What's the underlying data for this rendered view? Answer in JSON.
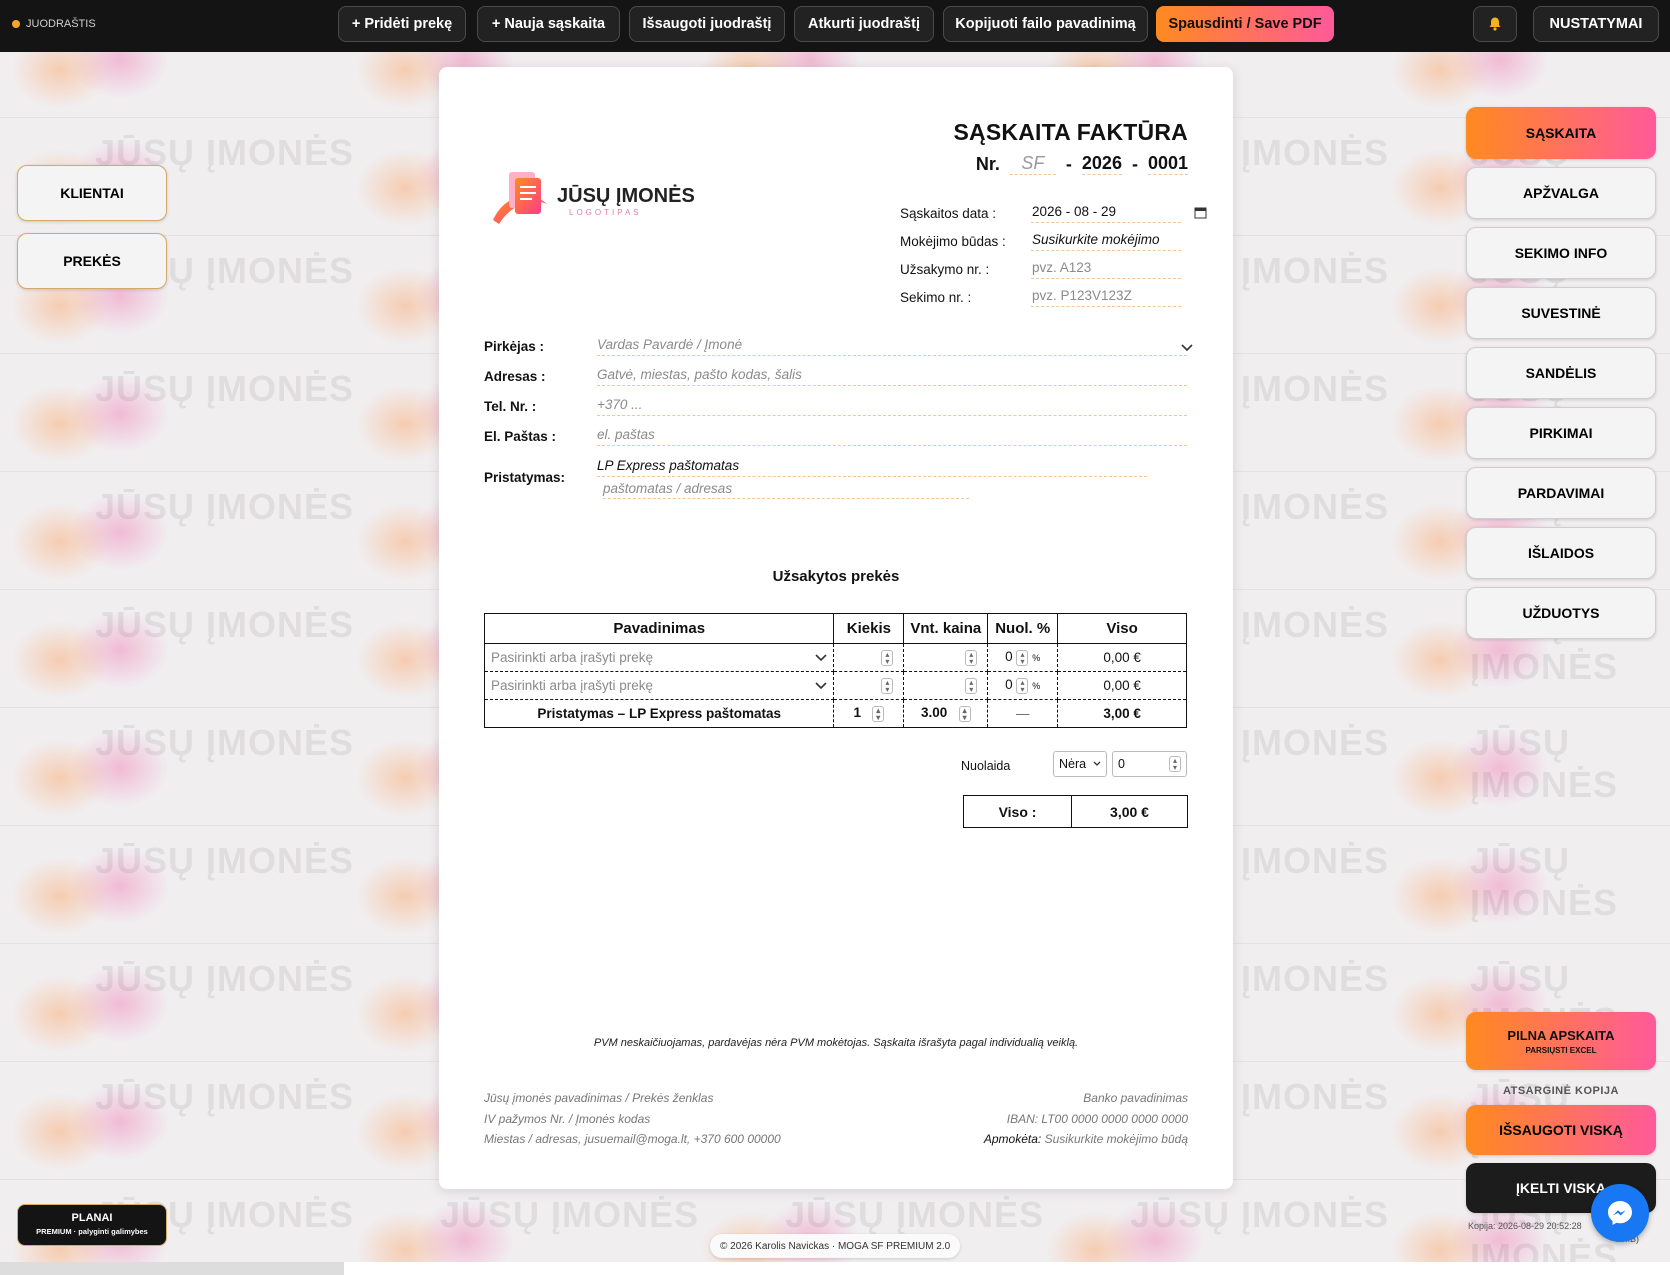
{
  "topbar": {
    "draft_label": "JUODRAŠTIS",
    "buttons": [
      "+ Pridėti prekę",
      "+ Nauja sąskaita",
      "Išsaugoti juodraštį",
      "Atkurti juodraštį",
      "Kopijuoti failo pavadinimą",
      "Spausdinti / Save PDF"
    ],
    "settings": "NUSTATYMAI"
  },
  "watermark": "JŪSŲ ĮMONĖS",
  "left_nav": [
    "KLIENTAI",
    "PREKĖS"
  ],
  "right_nav": [
    "SĄSKAITA",
    "APŽVALGA",
    "SEKIMO INFO",
    "SUVESTINĖ",
    "SANDĖLIS",
    "PIRKIMAI",
    "PARDAVIMAI",
    "IŠLAIDOS",
    "UŽDUOTYS"
  ],
  "right_bottom": {
    "full": "PILNA APSKAITA",
    "full_sub": "PARSIŲSTI EXCEL",
    "backup_label": "ATSARGINĖ KOPIJA",
    "save_all": "IŠSAUGOTI VISKĄ",
    "load_all": "ĮKELTI VISKĄ",
    "copy_info": "Kopija: 2026-08-29 20:52:28",
    "copy_info2": "0 MB)"
  },
  "plans": {
    "title": "PLANAI",
    "sub": "PREMIUM · palyginti galimybes"
  },
  "invoice": {
    "title": "SĄSKAITA FAKTŪRA",
    "nr_label": "Nr.",
    "nr_prefix": "SF",
    "nr_year": "2026",
    "nr_num": "0001",
    "dash": "-",
    "logo_name": "JŪSŲ ĮMONĖS",
    "logo_sub": "LOGOTIPAS",
    "meta": [
      {
        "label": "Sąskaitos data :",
        "value": "2026 - 08 - 29"
      },
      {
        "label": "Mokėjimo būdas :",
        "value": "Susikurkite mokėjimo"
      },
      {
        "label": "Užsakymo nr. :",
        "value": "pvz. A123"
      },
      {
        "label": "Sekimo nr. :",
        "value": "pvz. P123V123Z"
      }
    ],
    "buyer": [
      {
        "label": "Pirkėjas :",
        "value": "Vardas Pavardė / Įmonė"
      },
      {
        "label": "Adresas :",
        "value": "Gatvė, miestas, pašto kodas, šalis"
      },
      {
        "label": "Tel. Nr. :",
        "value": "+370 ..."
      },
      {
        "label": "El. Paštas :",
        "value": "el. paštas"
      }
    ],
    "delivery_label": "Pristatymas:",
    "delivery_value": "LP Express paštomatas",
    "delivery_ph": "paštomatas / adresas",
    "section_title": "Užsakytos prekės",
    "columns": [
      "Pavadinimas",
      "Kiekis",
      "Vnt. kaina",
      "Nuol. %",
      "Viso"
    ],
    "rows": [
      {
        "name": "Pasirinkti arba įrašyti prekę",
        "qty": "",
        "price": "",
        "disc": "0",
        "pct": "%",
        "total": "0,00 €"
      },
      {
        "name": "Pasirinkti arba įrašyti prekę",
        "qty": "",
        "price": "",
        "disc": "0",
        "pct": "%",
        "total": "0,00 €"
      }
    ],
    "delivery_row": {
      "name": "Pristatymas – LP Express paštomatas",
      "qty": "1",
      "price": "3.00",
      "disc": "—",
      "total": "3,00 €"
    },
    "discount_label": "Nuolaida",
    "discount_type": "Nėra",
    "discount_value": "0",
    "total_label": "Viso :",
    "total_value": "3,00 €",
    "vat_note": "PVM neskaičiuojamas, pardavėjas nėra PVM mokėtojas. Sąskaita išrašyta pagal individualią veiklą.",
    "footer_left": [
      "Jūsų įmonės pavadinimas / Prekės ženklas",
      "IV pažymos Nr. / Įmonės kodas",
      "Miestas / adresas, jusuemail@moga.lt, +370 600 00000"
    ],
    "footer_right": [
      "Banko pavadinimas",
      "IBAN: LT00 0000 0000 0000 0000"
    ],
    "paid_label": "Apmokėta:",
    "paid_value": "Susikurkite mokėjimo būdą"
  },
  "credit": "© 2026 Karolis Navickas · MOGA SF PREMIUM 2.0",
  "colors": {
    "accent_start": "#ff8a1f",
    "accent_end": "#ff5a9a",
    "topbar": "#141414",
    "messenger": "#1877f2"
  }
}
